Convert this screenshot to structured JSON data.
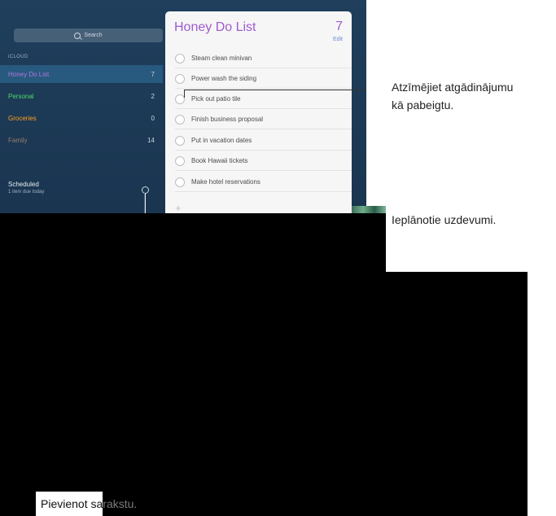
{
  "sidebar": {
    "search_placeholder": "Search",
    "section_label": "iCLOUD",
    "lists": [
      {
        "name": "Honey Do List",
        "count": "7",
        "color": "#a05ad0"
      },
      {
        "name": "Personal",
        "count": "2",
        "color": "#4cd964"
      },
      {
        "name": "Groceries",
        "count": "0",
        "color": "#ff9f1a"
      },
      {
        "name": "Family",
        "count": "14",
        "color": "#8a6a5a"
      }
    ],
    "scheduled_title": "Scheduled",
    "scheduled_sub": "1 item due today"
  },
  "panel": {
    "title": "Honey Do List",
    "count": "7",
    "edit_label": "Edit",
    "items": [
      "Steam clean minivan",
      "Power wash the siding",
      "Pick out patio tile",
      "Finish business proposal",
      "Put in vacation dates",
      "Book Hawaii tickets",
      "Make hotel reservations"
    ],
    "add_symbol": "+"
  },
  "callouts": {
    "mark_complete_line1": "Atzīmējiet atgādinājumu",
    "mark_complete_line2": "kā pabeigtu.",
    "scheduled_tasks": "Ieplānotie uzdevumi.",
    "add_list_part1": "Pievienot sa",
    "add_list_part2": "rakstu."
  }
}
